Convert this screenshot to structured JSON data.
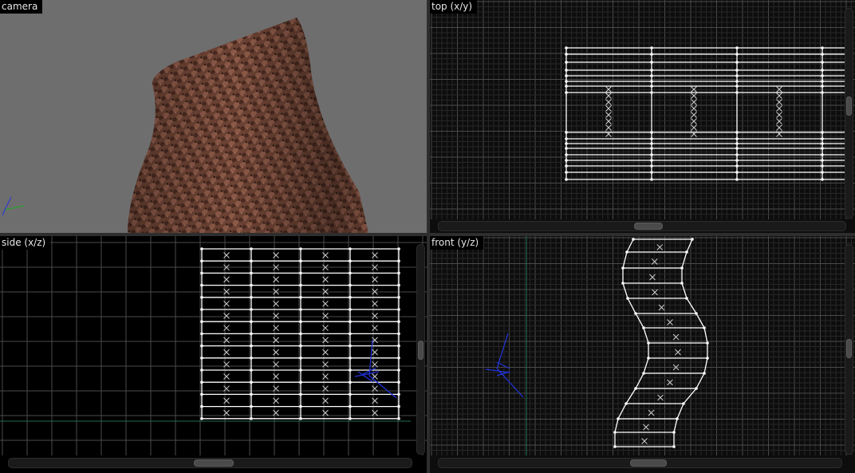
{
  "viewports": {
    "camera": {
      "label": "camera"
    },
    "top": {
      "label": "top (x/y)"
    },
    "side": {
      "label": "side (x/z)"
    },
    "front": {
      "label": "front (y/z)"
    }
  },
  "colors": {
    "camera_bg": "#6e6e6e",
    "ortho_bg": "#000000",
    "grid_minor": "#2a2a2a",
    "grid_major": "#484848",
    "wire": "#ffffff",
    "axis_gizmo": "#1a33cc",
    "surface_texture": "#7a4a3a"
  },
  "icons": {
    "vertex": "dot",
    "control_point": "x-mark",
    "light_gizmo": "blue-wire-gizmo",
    "axis_gizmo": "xyz-axes"
  }
}
